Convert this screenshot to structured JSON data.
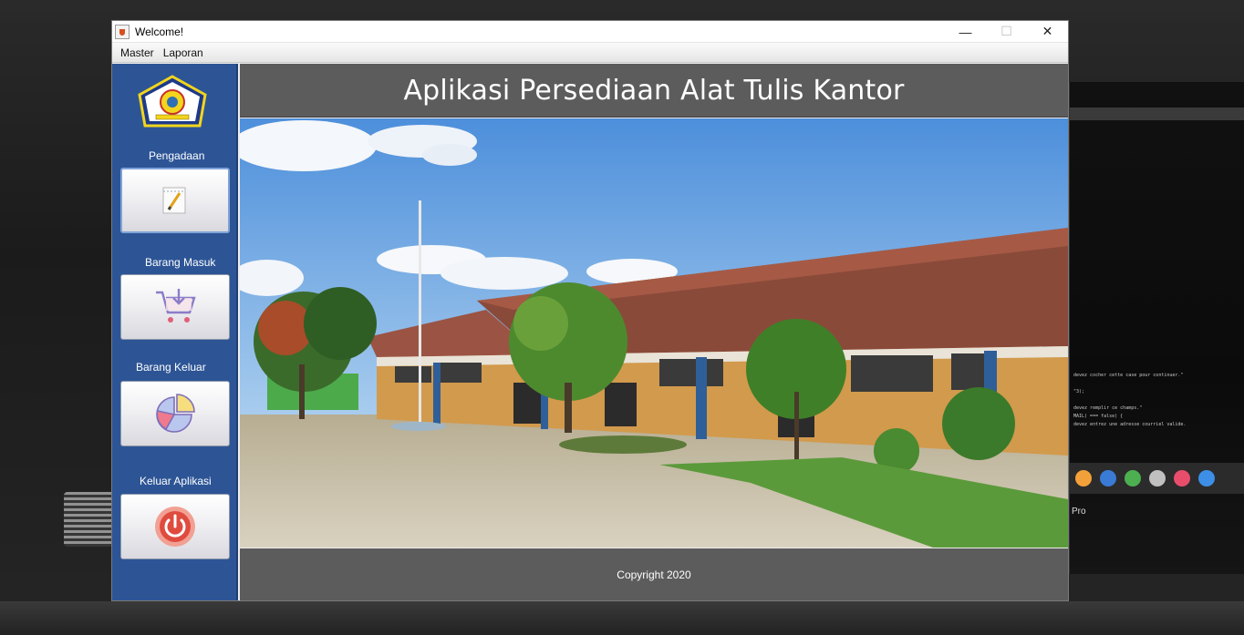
{
  "window": {
    "title": "Welcome!",
    "controls": {
      "minimize": "—",
      "maximize": "☐",
      "close": "✕"
    }
  },
  "menubar": {
    "items": [
      "Master",
      "Laporan"
    ]
  },
  "sidebar": {
    "items": [
      {
        "label": "Pengadaan",
        "icon": "notepad-pencil-icon"
      },
      {
        "label": "Barang Masuk",
        "icon": "shopping-cart-icon"
      },
      {
        "label": "Barang Keluar",
        "icon": "pie-chart-icon"
      },
      {
        "label": "Keluar Aplikasi",
        "icon": "power-icon"
      }
    ]
  },
  "header": {
    "title": "Aplikasi Persediaan Alat Tulis Kantor"
  },
  "footer": {
    "text": "Copyright 2020"
  },
  "colors": {
    "sidebar": "#2d5596",
    "panel": "#5c5c5c",
    "power_red": "#e04b3f",
    "logo_yellow": "#f2d51c"
  }
}
